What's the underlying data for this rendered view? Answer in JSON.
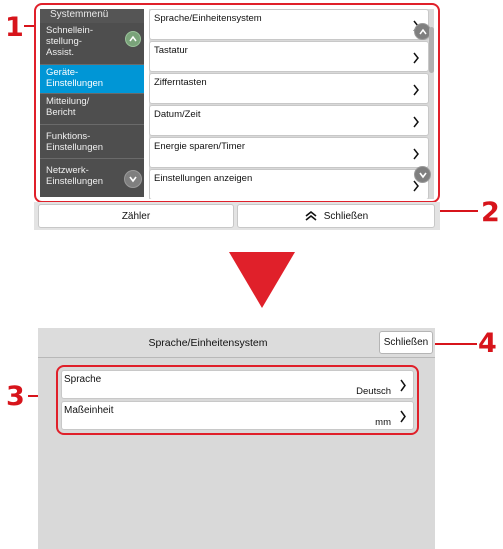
{
  "callouts": [
    "1",
    "2",
    "3",
    "4"
  ],
  "top_screen": {
    "sidebar": {
      "header": "Systemmenü",
      "items": [
        {
          "label": "Schnellein-stellung-Assist.",
          "lines": [
            "Schnellein-",
            "stellung-",
            "Assist."
          ],
          "active": false
        },
        {
          "label": "Geräte-Einstellungen",
          "lines": [
            "Geräte-",
            "Einstellungen"
          ],
          "active": true
        },
        {
          "label": "Mitteilung/Bericht",
          "lines": [
            "Mitteilung/",
            "Bericht"
          ],
          "active": false
        },
        {
          "label": "Funktions-Einstellungen",
          "lines": [
            "Funktions-",
            "Einstellungen"
          ],
          "active": false
        },
        {
          "label": "Netzwerk-Einstellungen",
          "lines": [
            "Netzwerk-",
            "Einstellungen"
          ],
          "active": false
        }
      ]
    },
    "menu_items": [
      "Sprache/Einheitensystem",
      "Tastatur",
      "Zifferntasten",
      "Datum/Zeit",
      "Energie sparen/Timer",
      "Einstellungen anzeigen"
    ],
    "bottom_bar": {
      "counter_label": "Zähler",
      "close_label": "Schließen"
    }
  },
  "bottom_screen": {
    "title": "Sprache/Einheitensystem",
    "close_label": "Schließen",
    "settings": [
      {
        "label": "Sprache",
        "value": "Deutsch"
      },
      {
        "label": "Maßeinheit",
        "value": "mm"
      }
    ]
  },
  "colors": {
    "accent_red": "#e0202a",
    "callout_red": "#d7141b",
    "selected_blue": "#0096d6",
    "sidebar_grey": "#4e4e4e"
  }
}
